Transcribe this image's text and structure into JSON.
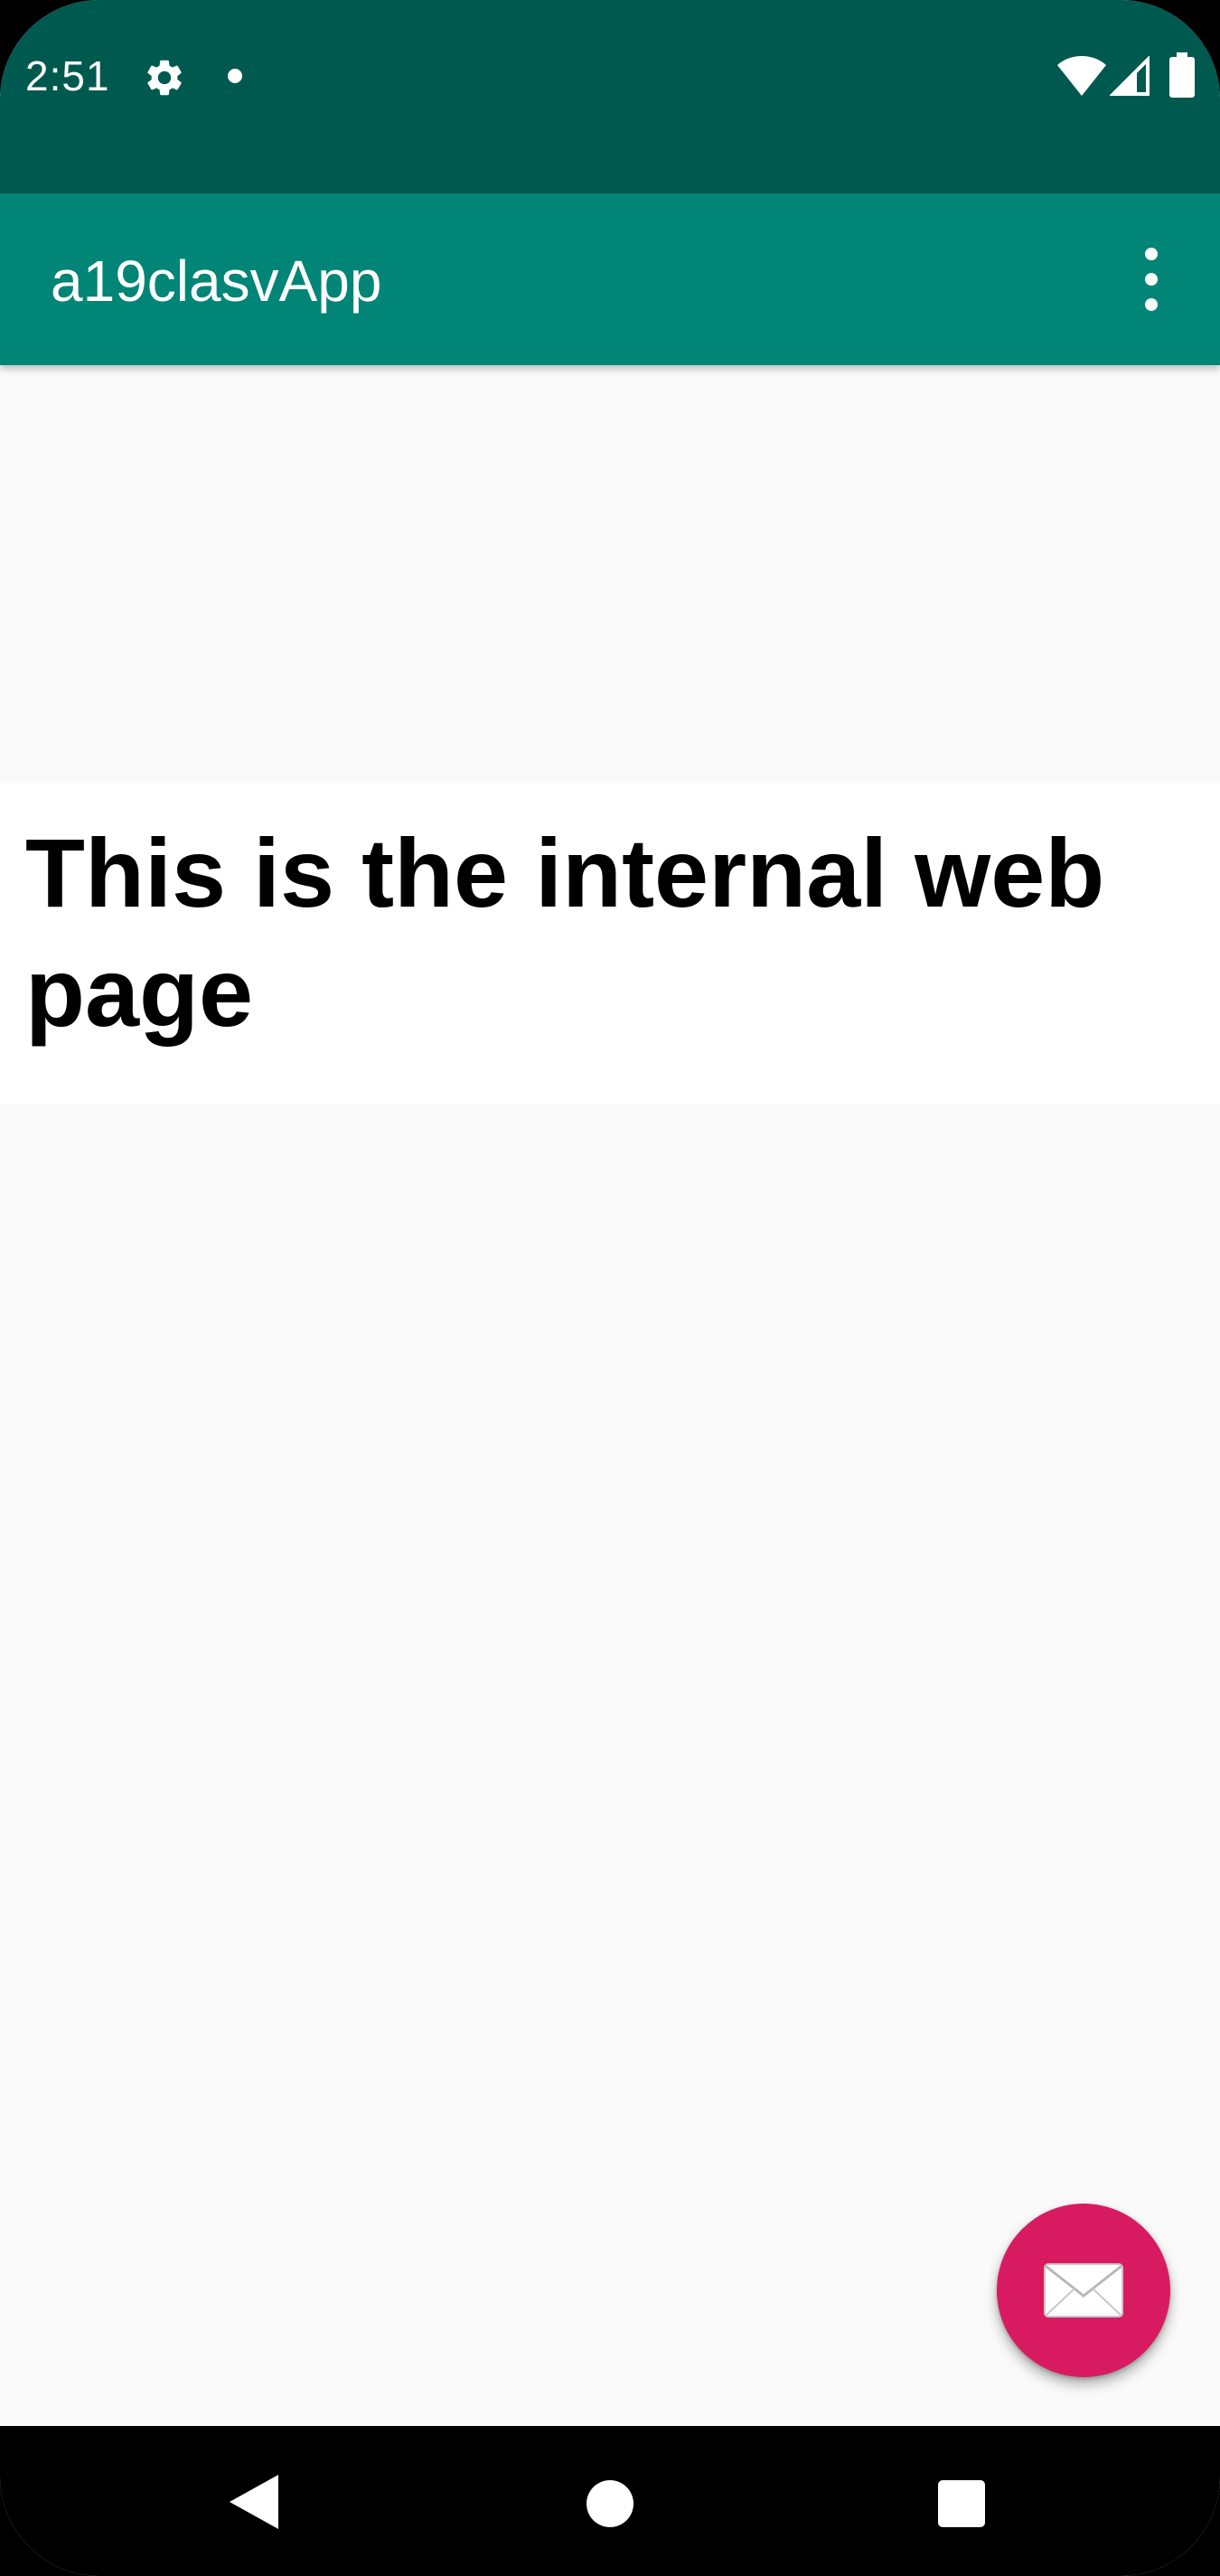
{
  "status_bar": {
    "time": "2:51",
    "icons": [
      "gear-icon",
      "notification-dot-icon",
      "wifi-icon",
      "signal-icon",
      "battery-icon"
    ],
    "background_color": "#00594f"
  },
  "app_bar": {
    "title": "a19clasvApp",
    "menu_icon": "more-vert-icon",
    "background_color": "#008577"
  },
  "webview": {
    "heading": "This is the internal web page"
  },
  "fab": {
    "icon": "email-icon",
    "color": "#d81b60"
  },
  "navigation_bar": {
    "buttons": [
      "back-icon",
      "home-icon",
      "recents-icon"
    ]
  }
}
